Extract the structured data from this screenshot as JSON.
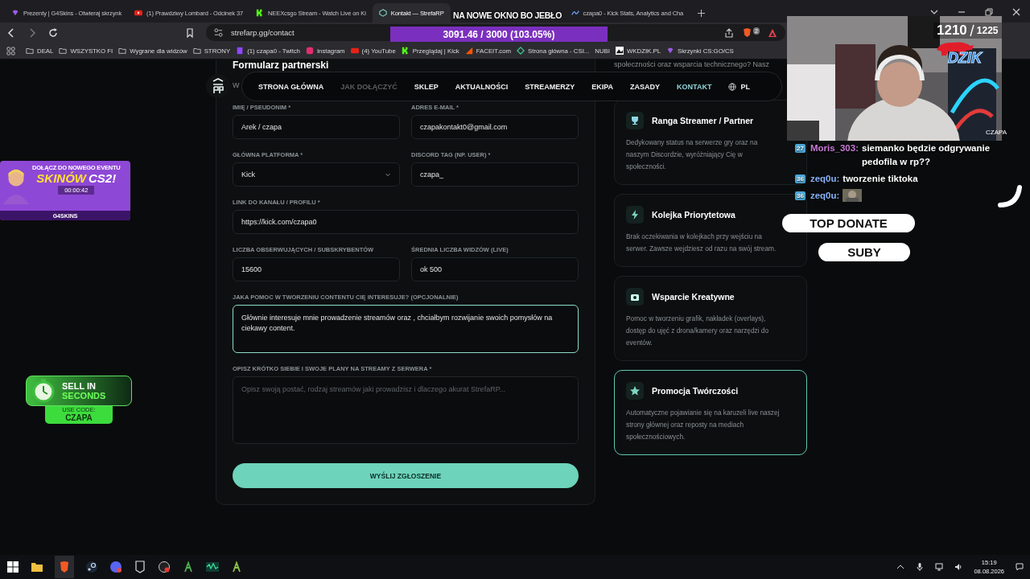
{
  "browser": {
    "tabs": [
      {
        "title": "Prezenty | G4Skins - Otwieraj skrzynk",
        "kind": "gem",
        "selected": false
      },
      {
        "title": "(1) Prawdziwy Lombard - Odcinek 37",
        "kind": "youtube",
        "selected": false
      },
      {
        "title": "NEEXcsgo Stream - Watch Live on Ki",
        "kind": "kick",
        "selected": false
      },
      {
        "title": "Kontakt — StrefaRP",
        "kind": "strefa",
        "selected": true
      },
      {
        "title": "czapa0 - Kick Stats, Analytics and Cha",
        "kind": "stats",
        "selected": false
      }
    ],
    "address": "strefarp.gg/contact",
    "shield_badge": "2",
    "bookmarks": [
      {
        "label": "DEAL",
        "kind": "folder"
      },
      {
        "label": "WSZYSTKO FI",
        "kind": "folder"
      },
      {
        "label": "Wygrane dla widzów",
        "kind": "folder"
      },
      {
        "label": "STRONY",
        "kind": "folder"
      },
      {
        "label": "(1) czapa0 - Twitch",
        "kind": "twitch"
      },
      {
        "label": "Instagram",
        "kind": "instagram"
      },
      {
        "label": "(4) YouTube",
        "kind": "youtube"
      },
      {
        "label": "Przeglądaj | Kick",
        "kind": "kick"
      },
      {
        "label": "FACEIT.com",
        "kind": "faceit"
      },
      {
        "label": "Strona główna - CSI...",
        "kind": "diamond"
      },
      {
        "label": "NUBI",
        "kind": "blank"
      },
      {
        "label": "WKDZIK.PL",
        "kind": "mountain"
      },
      {
        "label": "Skrzynki CS:GO/CS",
        "kind": "gem"
      }
    ]
  },
  "nav": {
    "items": [
      {
        "label": "STRONA GŁÓWNA",
        "selected": false,
        "dimmed": false
      },
      {
        "label": "JAK DOŁĄCZYĆ",
        "selected": false,
        "dimmed": true
      },
      {
        "label": "SKLEP",
        "selected": false,
        "dimmed": false
      },
      {
        "label": "AKTUALNOŚCI",
        "selected": false,
        "dimmed": false
      },
      {
        "label": "STREAMERZY",
        "selected": false,
        "dimmed": false
      },
      {
        "label": "EKIPA",
        "selected": false,
        "dimmed": false
      },
      {
        "label": "ZASADY",
        "selected": false,
        "dimmed": false
      },
      {
        "label": "KONTAKT",
        "selected": true,
        "dimmed": false
      }
    ],
    "language": "PL"
  },
  "form": {
    "title": "Formularz partnerski",
    "subtitle": "W",
    "rows": [
      [
        {
          "label": "IMIĘ / PSEUDONIM *",
          "kind": "text",
          "value": "Arek / czapa"
        },
        {
          "label": "ADRES E-MAIL *",
          "kind": "text",
          "value": "czapakontakt0@gmail.com"
        }
      ],
      [
        {
          "label": "GŁÓWNA PLATFORMA *",
          "kind": "select",
          "value": "Kick"
        },
        {
          "label": "DISCORD TAG (NP. USER) *",
          "kind": "text",
          "value": "czapa_"
        }
      ],
      [
        {
          "label": "LINK DO KANAŁU / PROFILU *",
          "kind": "text",
          "value": "https://kick.com/czapa0"
        }
      ],
      [
        {
          "label": "LICZBA OBSERWUJĄCYCH / SUBSKRYBENTÓW",
          "kind": "text",
          "value": "15600"
        },
        {
          "label": "ŚREDNIA LICZBA WIDZÓW (LIVE)",
          "kind": "text",
          "value": "ok 500"
        }
      ],
      [
        {
          "label": "JAKA POMOC W TWORZENIU CONTENTU CIĘ INTERESUJE? (OPCJONALNIE)",
          "kind": "textarea",
          "value": "Głównie interesuje mnie  prowadzenie streamów oraz , chciałbym rozwijanie swoich pomysłów na ciekawy content.",
          "focused": true
        }
      ],
      [
        {
          "label": "OPISZ KRÓTKO SIEBIE I SWOJE PLANY NA STREAMY Z SERWERA *",
          "kind": "textarea",
          "placeholder": "Opisz swoją postać, rodzaj streamów jaki prowadzisz i dlaczego akurat StrefaRP...",
          "focused": false
        }
      ]
    ],
    "submit": "WYŚLIJ ZGŁOSZENIE"
  },
  "benefits": {
    "intro": "społeczności oraz wsparcia technicznego? Nasz",
    "cards": [
      {
        "kind": "trophy",
        "title": "Ranga Streamer / Partner",
        "text": "Dedykowany status na serwerze gry oraz na naszym Discordzie, wyróżniający Cię w społeczności.",
        "highlighted": false
      },
      {
        "kind": "bolt",
        "title": "Kolejka Priorytetowa",
        "text": "Brak oczekiwania w kolejkach przy wejściu na serwer. Zawsze wejdziesz od razu na swój stream.",
        "highlighted": false
      },
      {
        "kind": "camera",
        "title": "Wsparcie Kreatywne",
        "text": "Pomoc w tworzeniu grafik, nakładek (overlays), dostęp do ujęć z drona/kamery oraz narzędzi do eventów.",
        "highlighted": false
      },
      {
        "kind": "star",
        "title": "Promocja Twórczości",
        "text": "Automatyczne pojawianie się na karuzeli live naszej strony głównej oraz reposty na mediach społecznościowych.",
        "highlighted": true
      }
    ]
  },
  "stream_overlay": {
    "alert": "NA NOWE OKNO BO JEBŁO",
    "goal": {
      "text": "3091.46 / 3000 (103.05%)",
      "level": 1
    },
    "counter": {
      "current": "1210",
      "total": "1225"
    },
    "logo_text": "DZIK",
    "cam_label": "CZAPA",
    "chat": [
      {
        "kind": "text",
        "badge": "27",
        "user": "Moris_303:",
        "color": "#c77ad6",
        "text": "siemanko będzie odgrywanie pedofila w rp??"
      },
      {
        "kind": "text",
        "badge": "36",
        "user": "zeq0u:",
        "color": "#8ab4f8",
        "text": "tworzenie tiktoka"
      },
      {
        "kind": "emote",
        "badge": "36",
        "user": "zeq0u:",
        "color": "#8ab4f8"
      }
    ],
    "pills": [
      "TOP DONATE",
      "SUBY"
    ],
    "event_ad": {
      "line1": "DOŁĄCZ DO NOWEGO EVENTU",
      "word1": "SKINÓW",
      "word2": "CS2!",
      "timer": "00:00:42",
      "brand": "G4SKINS"
    },
    "sell_ad": {
      "line1": "SELL IN",
      "line2": "SECONDS",
      "code_label": "USE CODE:",
      "code": "CZAPA"
    }
  },
  "taskbar": {
    "time": "15:19",
    "date": "08.08.2026"
  }
}
